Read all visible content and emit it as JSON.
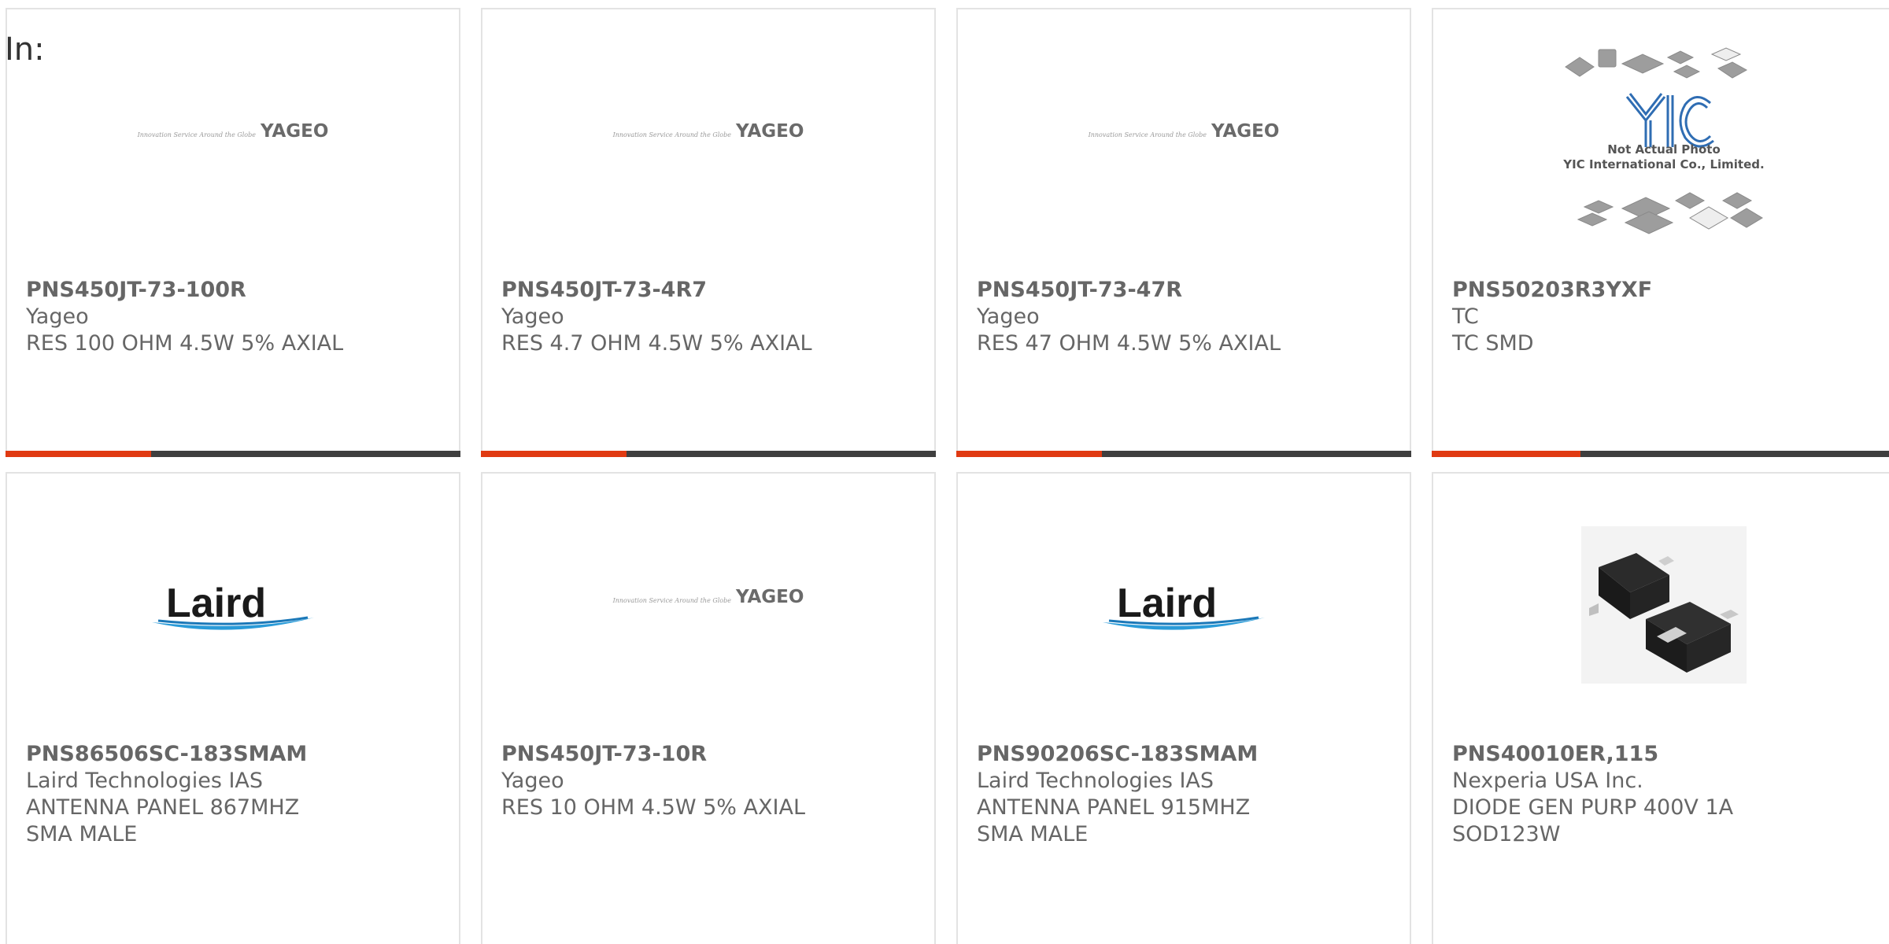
{
  "page": {
    "in_label": "In:"
  },
  "colors": {
    "progress_fill": "#e03a12",
    "progress_track": "#3f3f3f",
    "card_border": "#e3e3e3",
    "text": "#666666"
  },
  "cards": [
    {
      "part": "PNS450JT-73-100R",
      "manufacturer": "Yageo",
      "description": "RES 100 OHM 4.5W 5% AXIAL",
      "logo": "yageo-logo",
      "logo_tagline": "Innovation Service Around the Globe",
      "logo_text": "YAGEO",
      "progress": 0.32
    },
    {
      "part": "PNS450JT-73-4R7",
      "manufacturer": "Yageo",
      "description": "RES 4.7 OHM 4.5W 5% AXIAL",
      "logo": "yageo-logo",
      "logo_tagline": "Innovation Service Around the Globe",
      "logo_text": "YAGEO",
      "progress": 0.32
    },
    {
      "part": "PNS450JT-73-47R",
      "manufacturer": "Yageo",
      "description": "RES 47 OHM 4.5W 5% AXIAL",
      "logo": "yageo-logo",
      "logo_tagline": "Innovation Service Around the Globe",
      "logo_text": "YAGEO",
      "progress": 0.32
    },
    {
      "part": "PNS50203R3YXF",
      "manufacturer": "TC",
      "description": "TC SMD",
      "logo": "yic-placeholder-image",
      "logo_text": "YIC",
      "note_line1": "Not Actual Photo",
      "note_line2": "YIC International Co., Limited.",
      "progress": 0.32
    },
    {
      "part": "PNS86506SC-183SMAM",
      "manufacturer": "Laird Technologies IAS",
      "description": "ANTENNA PANEL 867MHZ SMA MALE",
      "logo": "laird-logo",
      "logo_text": "Laird"
    },
    {
      "part": "PNS450JT-73-10R",
      "manufacturer": "Yageo",
      "description": "RES 10 OHM 4.5W 5% AXIAL",
      "logo": "yageo-logo",
      "logo_tagline": "Innovation Service Around the Globe",
      "logo_text": "YAGEO"
    },
    {
      "part": "PNS90206SC-183SMAM",
      "manufacturer": "Laird Technologies IAS",
      "description": "ANTENNA PANEL 915MHZ SMA MALE",
      "logo": "laird-logo",
      "logo_text": "Laird"
    },
    {
      "part": "PNS40010ER,115",
      "manufacturer": "Nexperia USA Inc.",
      "description": "DIODE GEN PURP 400V 1A SOD123W",
      "logo": "diode-product-image"
    }
  ]
}
